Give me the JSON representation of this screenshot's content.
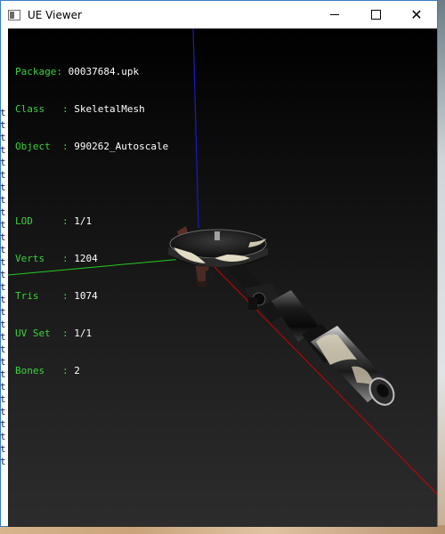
{
  "window": {
    "title": "UE Viewer"
  },
  "info": {
    "package_label": "Package: ",
    "package_value": "00037684.upk",
    "class_label": "Class   : ",
    "class_value": "SkeletalMesh",
    "object_label": "Object  : ",
    "object_value": "990262_Autoscale",
    "lod_label": "LOD     : ",
    "lod_value": "1/1",
    "verts_label": "Verts   : ",
    "verts_value": "1204",
    "tris_label": "Tris    : ",
    "tris_value": "1074",
    "uvset_label": "UV Set  : ",
    "uvset_value": "1/1",
    "bones_label": "Bones   : ",
    "bones_value": "2"
  },
  "colors": {
    "label_green": "#3cd23c",
    "axis_x": "#cc0000",
    "axis_y": "#22cc22",
    "axis_z": "#1a1acc"
  },
  "desktop_glyphs": [
    "t",
    "t",
    "t",
    "t",
    "t",
    "t",
    "t",
    "t",
    "t",
    "t",
    "t",
    "t",
    "t",
    "t",
    "t",
    "t",
    "t",
    "t",
    "t",
    "t",
    "t",
    "t",
    "t",
    "t",
    "t",
    "t",
    "t",
    "t",
    "t"
  ]
}
